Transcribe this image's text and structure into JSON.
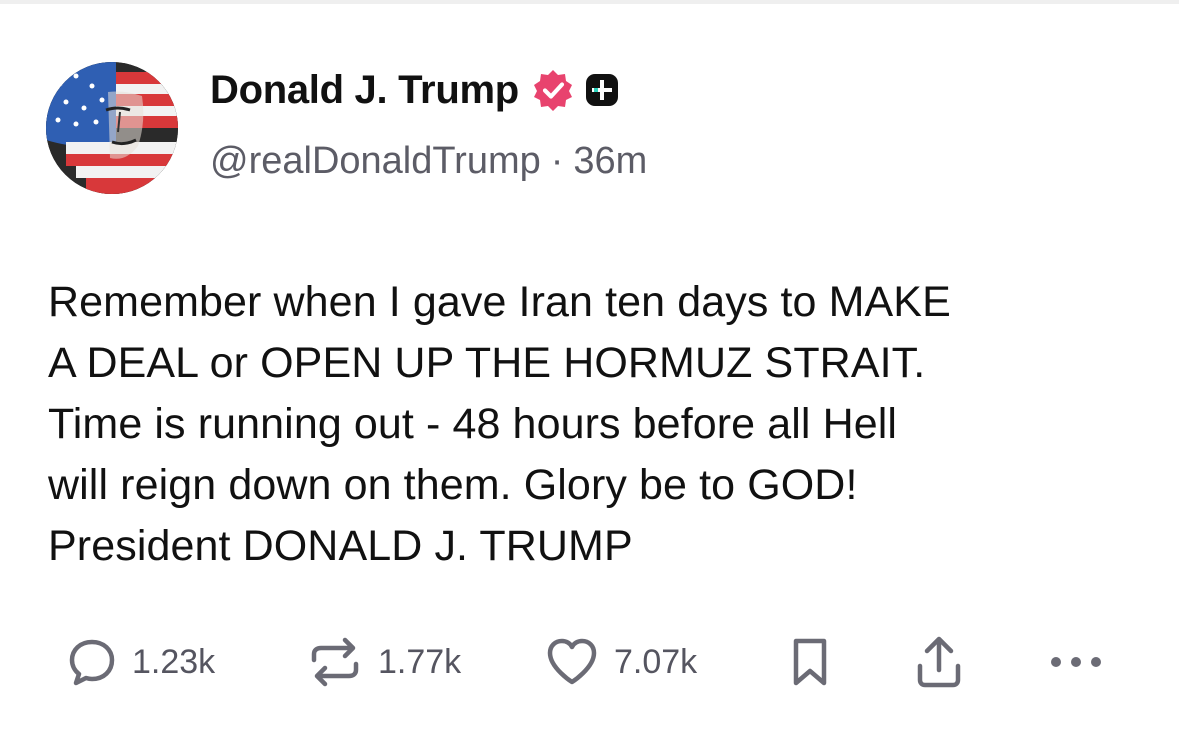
{
  "author": {
    "display_name": "Donald J. Trump",
    "handle": "@realDonaldTrump",
    "separator": "·",
    "timestamp": "36m",
    "verified_color": "#e8436e",
    "avatar_icon": "avatar-flag-portrait"
  },
  "post": {
    "lines": [
      "Remember when I gave Iran ten days to MAKE",
      "A DEAL or OPEN UP THE HORMUZ STRAIT.",
      "Time is running out - 48 hours before all Hell",
      "will reign down on them. Glory be to GOD!",
      "President DONALD J. TRUMP"
    ]
  },
  "actions": {
    "reply": {
      "icon": "reply-icon",
      "count": "1.23k"
    },
    "repost": {
      "icon": "repost-icon",
      "count": "1.77k"
    },
    "like": {
      "icon": "heart-icon",
      "count": "7.07k"
    },
    "bookmark": {
      "icon": "bookmark-icon"
    },
    "share": {
      "icon": "share-icon"
    },
    "more": {
      "icon": "more-icon"
    }
  },
  "colors": {
    "text": "#111111",
    "muted": "#5c5c66",
    "icon": "#6b6b75"
  }
}
